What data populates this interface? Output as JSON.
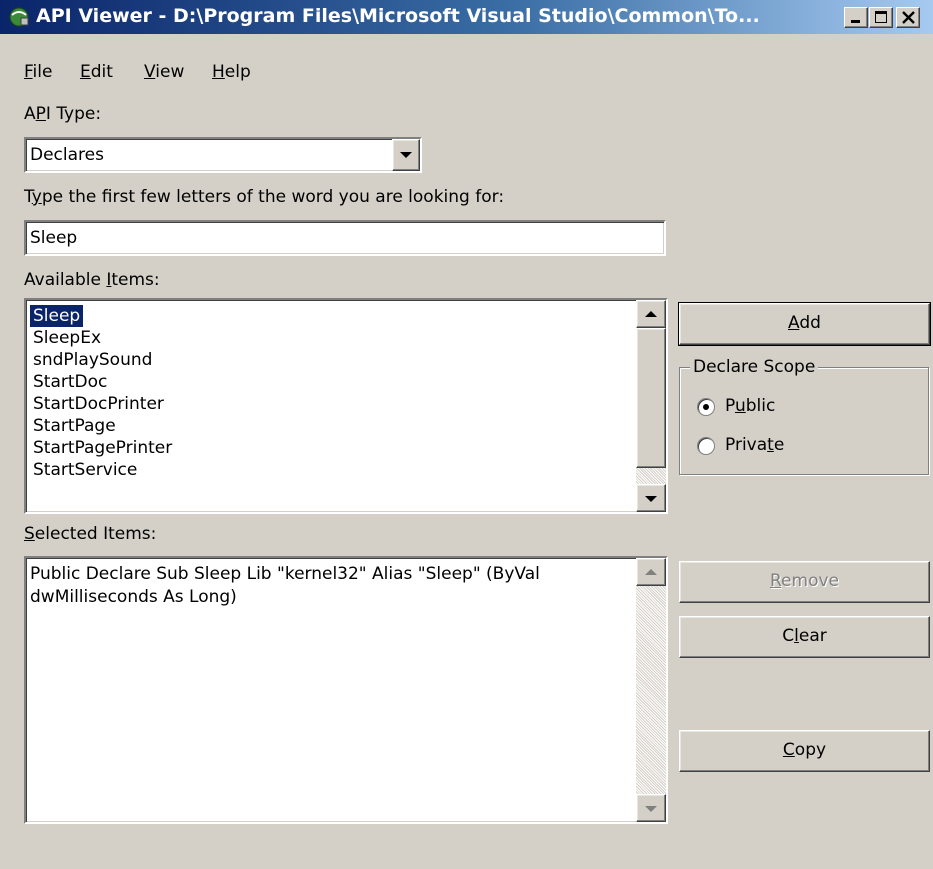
{
  "window": {
    "title": "API Viewer - D:\\Program Files\\Microsoft Visual Studio\\Common\\To...",
    "title_bar_color": "#0a246a"
  },
  "menu": [
    {
      "pre": "",
      "key": "F",
      "post": "ile"
    },
    {
      "pre": "",
      "key": "E",
      "post": "dit"
    },
    {
      "pre": "",
      "key": "V",
      "post": "iew"
    },
    {
      "pre": "",
      "key": "H",
      "post": "elp"
    }
  ],
  "api_type": {
    "label_pre": "A",
    "label_key": "P",
    "label_post": "I Type:",
    "selected": "Declares"
  },
  "search": {
    "label_pre": "T",
    "label_key": "y",
    "label_post": "pe the first few letters of the word you are looking for:",
    "value": "Sleep"
  },
  "available": {
    "label_pre": "Available ",
    "label_key": "I",
    "label_post": "tems:",
    "items": [
      "Sleep",
      "SleepEx",
      "sndPlaySound",
      "StartDoc",
      "StartDocPrinter",
      "StartPage",
      "StartPagePrinter",
      "StartService"
    ],
    "selected_index": 0
  },
  "selected": {
    "label_pre": "",
    "label_key": "S",
    "label_post": "elected Items:",
    "text": "Public Declare Sub Sleep Lib \"kernel32\" Alias \"Sleep\" (ByVal dwMilliseconds As Long)"
  },
  "buttons": {
    "add": {
      "pre": "",
      "key": "A",
      "post": "dd"
    },
    "remove": {
      "pre": "",
      "key": "R",
      "post": "emove"
    },
    "clear": {
      "pre": "C",
      "key": "l",
      "post": "ear"
    },
    "copy": {
      "pre": "",
      "key": "C",
      "post": "opy"
    }
  },
  "scope": {
    "title": "Declare Scope",
    "public": {
      "pre": "P",
      "key": "u",
      "post": "blic",
      "checked": true
    },
    "private": {
      "pre": "Priva",
      "key": "t",
      "post": "e",
      "checked": false
    }
  }
}
